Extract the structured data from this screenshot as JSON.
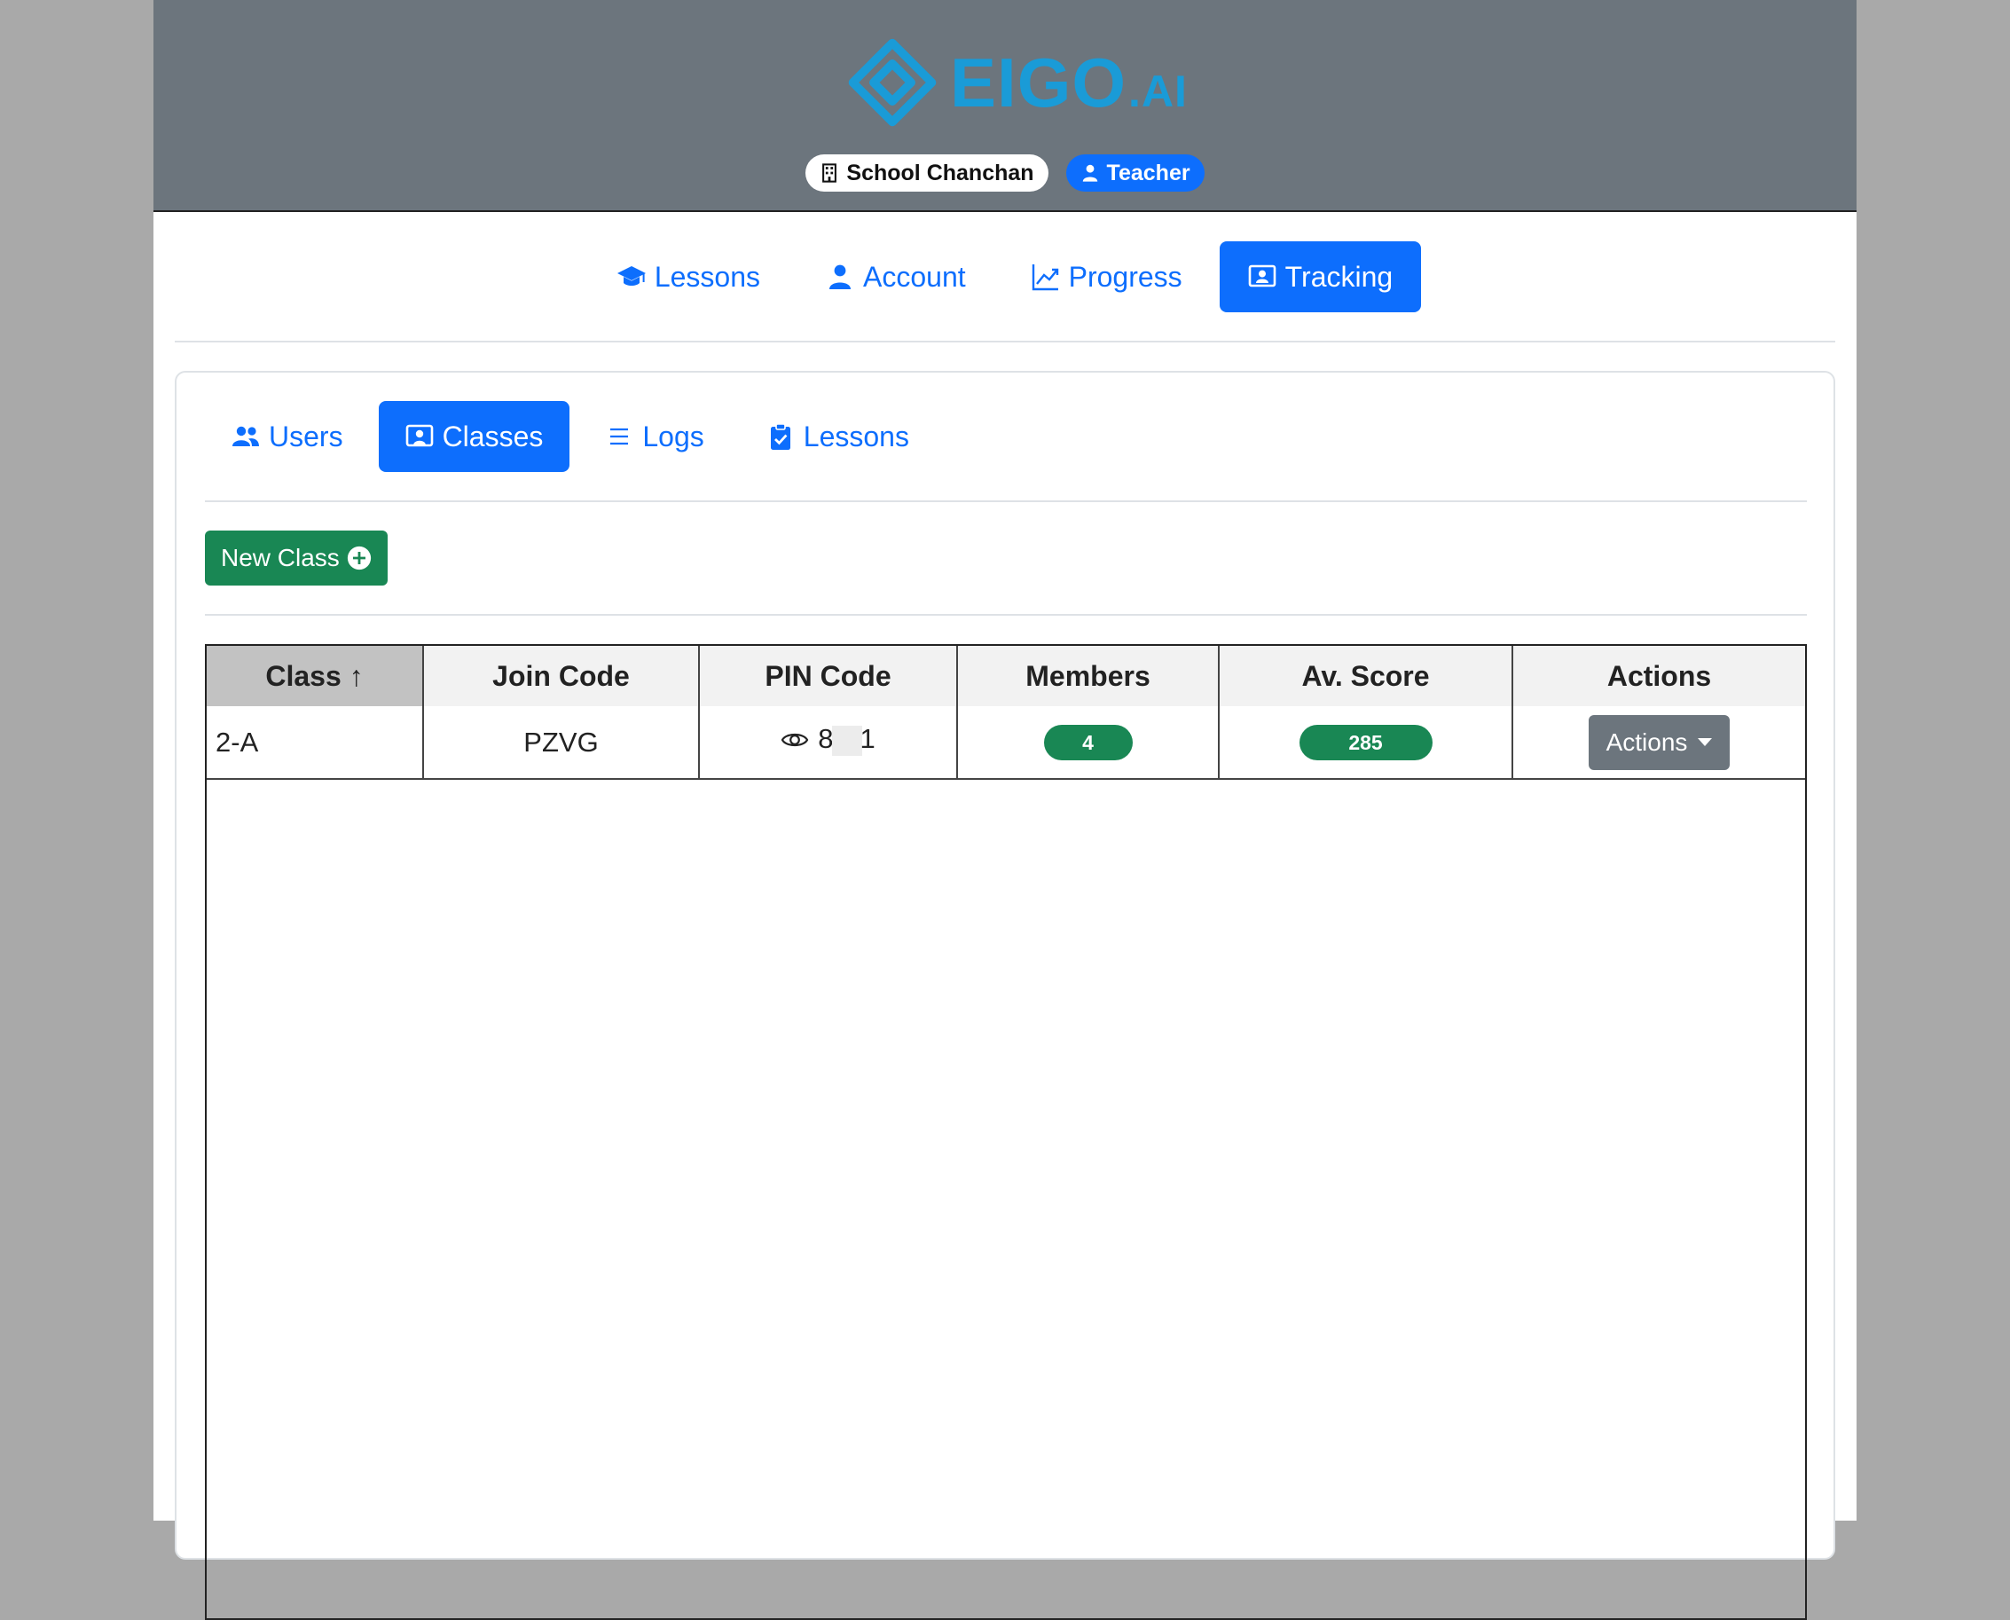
{
  "header": {
    "logo_text": "EIGO",
    "logo_suffix": ".AI",
    "school_badge": "School Chanchan",
    "role_badge": "Teacher",
    "brand_color": "#1a9bd7"
  },
  "main_nav": {
    "items": [
      {
        "label": "Lessons",
        "icon": "graduation-cap-icon"
      },
      {
        "label": "Account",
        "icon": "person-icon"
      },
      {
        "label": "Progress",
        "icon": "graph-up-icon"
      },
      {
        "label": "Tracking",
        "icon": "person-badge-icon",
        "active": true
      }
    ]
  },
  "sub_nav": {
    "items": [
      {
        "label": "Users",
        "icon": "people-icon"
      },
      {
        "label": "Classes",
        "icon": "person-video-icon",
        "active": true
      },
      {
        "label": "Logs",
        "icon": "list-icon"
      },
      {
        "label": "Lessons",
        "icon": "clipboard-check-icon"
      }
    ]
  },
  "toolbar": {
    "new_class_label": "New Class"
  },
  "table": {
    "headers": {
      "class": "Class",
      "join_code": "Join Code",
      "pin_code": "PIN Code",
      "members": "Members",
      "av_score": "Av. Score",
      "actions": "Actions"
    },
    "sort_indicator": "↑",
    "rows": [
      {
        "class": "2-A",
        "join_code": "PZVG",
        "pin_start": "8",
        "pin_end": "1",
        "members": "4",
        "av_score": "285",
        "actions_label": "Actions"
      }
    ]
  },
  "colors": {
    "header_bg": "#6c757d",
    "primary": "#0d6efd",
    "success": "#198754",
    "secondary": "#6c757d"
  }
}
